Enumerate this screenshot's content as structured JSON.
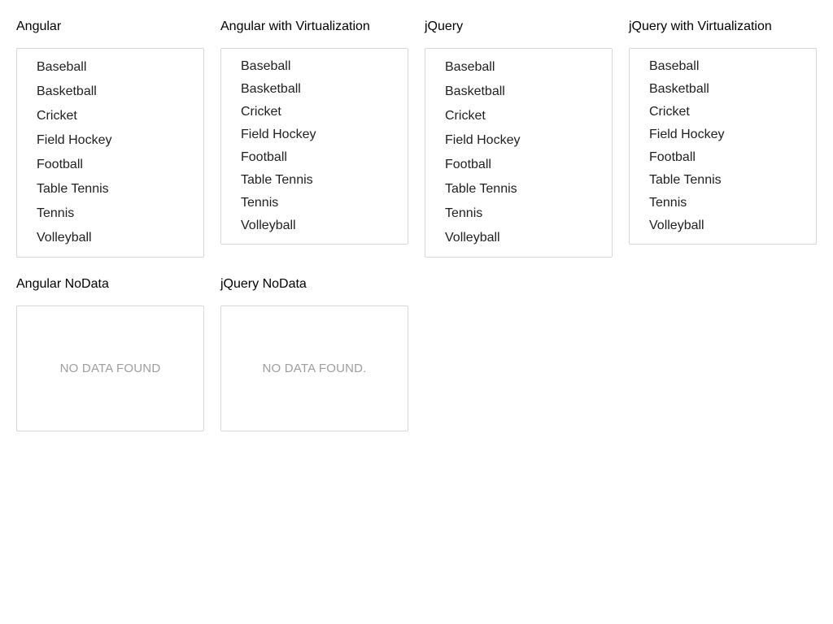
{
  "sections": [
    {
      "title": "Angular",
      "items": [
        "Baseball",
        "Basketball",
        "Cricket",
        "Field Hockey",
        "Football",
        "Table Tennis",
        "Tennis",
        "Volleyball"
      ]
    },
    {
      "title": "Angular with Virtualization",
      "items": [
        "Baseball",
        "Basketball",
        "Cricket",
        "Field Hockey",
        "Football",
        "Table Tennis",
        "Tennis",
        "Volleyball"
      ]
    },
    {
      "title": "jQuery",
      "items": [
        "Baseball",
        "Basketball",
        "Cricket",
        "Field Hockey",
        "Football",
        "Table Tennis",
        "Tennis",
        "Volleyball"
      ]
    },
    {
      "title": "jQuery with Virtualization",
      "items": [
        "Baseball",
        "Basketball",
        "Cricket",
        "Field Hockey",
        "Football",
        "Table Tennis",
        "Tennis",
        "Volleyball"
      ]
    },
    {
      "title": "Angular NoData",
      "empty_text": "NO DATA FOUND"
    },
    {
      "title": "jQuery NoData",
      "empty_text": "NO DATA FOUND."
    }
  ]
}
